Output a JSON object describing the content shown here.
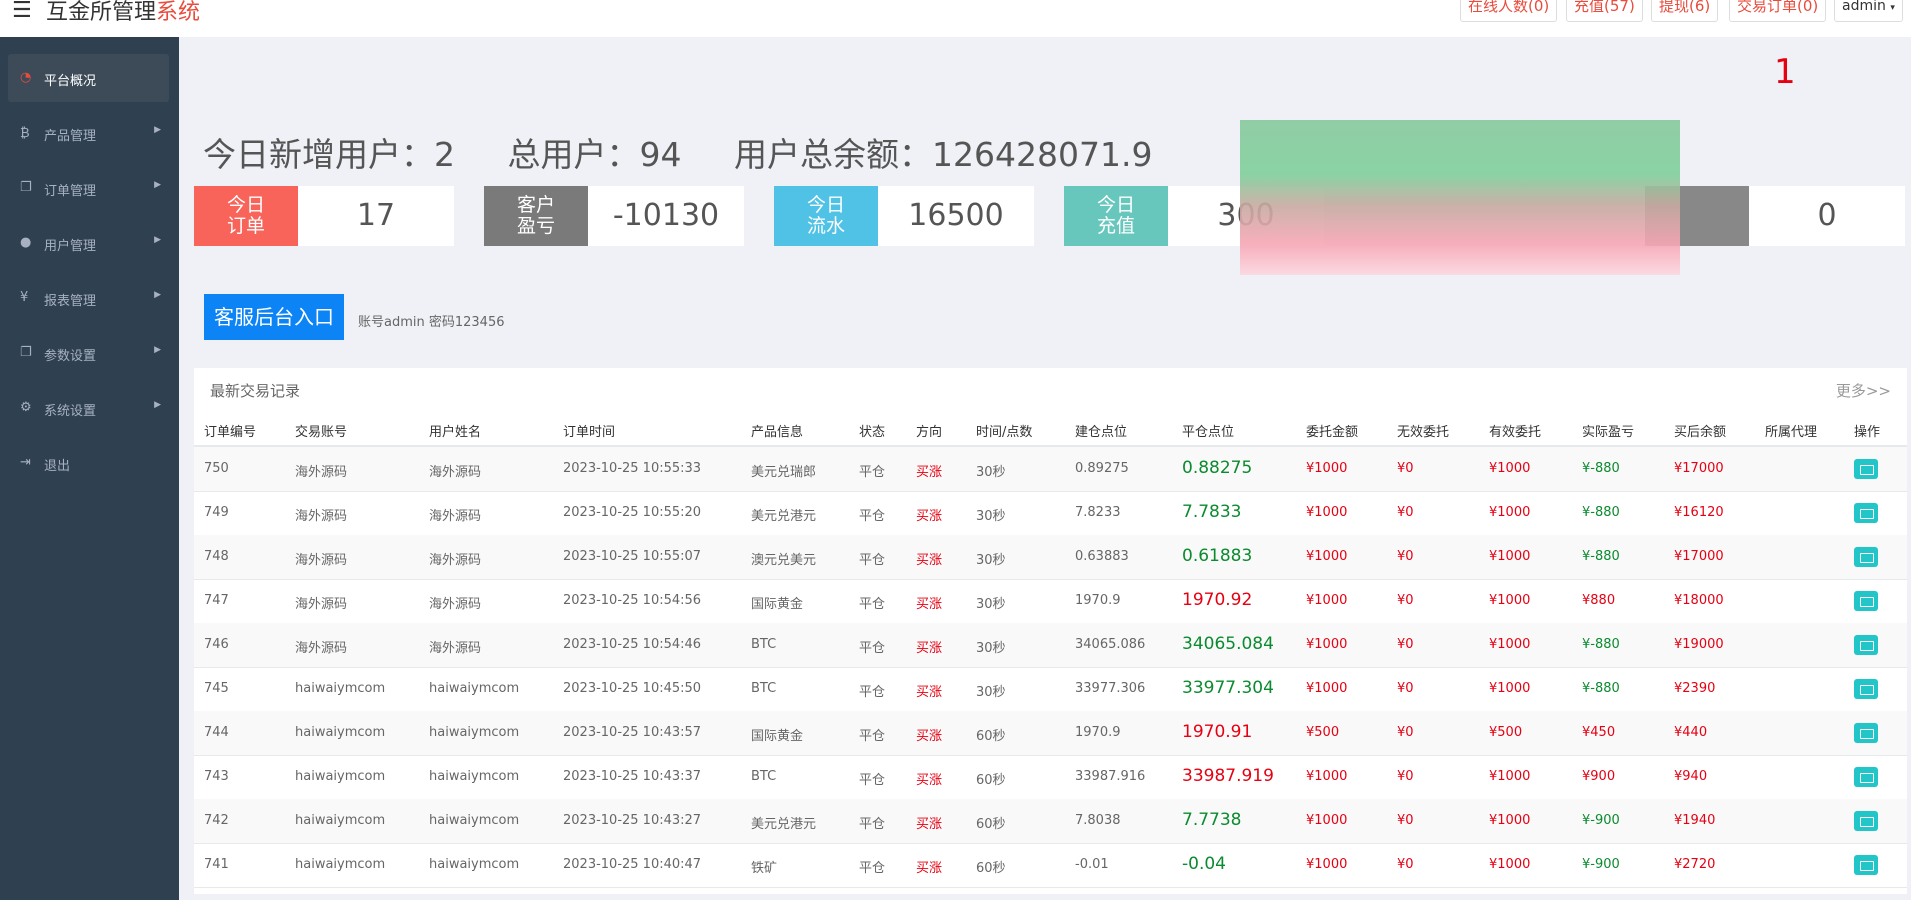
{
  "header": {
    "title_main": "互金所管理",
    "title_accent": "系统",
    "buttons": [
      {
        "label": "在线人数(0)"
      },
      {
        "label": "充值(57)"
      },
      {
        "label": "提现(6)"
      },
      {
        "label": "交易订单(0)"
      }
    ],
    "admin_label": "admin"
  },
  "sidebar": {
    "items": [
      {
        "label": "平台概况",
        "icon": "dashboard-icon",
        "active": true
      },
      {
        "label": "产品管理",
        "icon": "bitcoin-icon"
      },
      {
        "label": "订单管理",
        "icon": "copy-icon"
      },
      {
        "label": "用户管理",
        "icon": "user-icon"
      },
      {
        "label": "报表管理",
        "icon": "yen-icon"
      },
      {
        "label": "参数设置",
        "icon": "copy-icon"
      },
      {
        "label": "系统设置",
        "icon": "gears-icon"
      },
      {
        "label": "退出",
        "icon": "sign-out-icon"
      }
    ]
  },
  "notice_number": "1",
  "stats": {
    "today_new_users": "今日新增用户：2",
    "total_users": "总用户：94",
    "total_balance": "用户总余额：126428071.9"
  },
  "cards": [
    {
      "label": "今日\n订单",
      "value": "17",
      "color": "#f8635a"
    },
    {
      "label": "客户\n盈亏",
      "value": "-10130",
      "color": "#7a7a7a"
    },
    {
      "label": "今日\n流水",
      "value": "16500",
      "color": "#4fc2e5"
    },
    {
      "label": "今日\n充值",
      "value": "300",
      "color": "#67c7bd"
    },
    {
      "label": "",
      "value": "0",
      "color": "#888888"
    }
  ],
  "cs_entry": {
    "button_label": "客服后台入口",
    "hint": "账号admin 密码123456"
  },
  "trades": {
    "title": "最新交易记录",
    "more": "更多>>",
    "columns": [
      "订单编号",
      "交易账号",
      "用户姓名",
      "订单时间",
      "产品信息",
      "状态",
      "方向",
      "时间/点数",
      "建仓点位",
      "平仓点位",
      "委托金额",
      "无效委托",
      "有效委托",
      "实际盈亏",
      "买后余额",
      "所属代理",
      "操作"
    ],
    "rows": [
      {
        "id": "750",
        "account": "海外源码",
        "name": "海外源码",
        "time": "2023-10-25 10:55:33",
        "product": "美元兑瑞郎",
        "status": "平仓",
        "direction": "买涨",
        "period": "30秒",
        "open": "0.89275",
        "close": "0.88275",
        "close_up": false,
        "amount": "¥1000",
        "invalid": "¥0",
        "valid": "¥1000",
        "pnl": "¥-880",
        "pnl_up": false,
        "balance": "¥17000",
        "agent": ""
      },
      {
        "id": "749",
        "account": "海外源码",
        "name": "海外源码",
        "time": "2023-10-25 10:55:20",
        "product": "美元兑港元",
        "status": "平仓",
        "direction": "买涨",
        "period": "30秒",
        "open": "7.8233",
        "close": "7.7833",
        "close_up": false,
        "amount": "¥1000",
        "invalid": "¥0",
        "valid": "¥1000",
        "pnl": "¥-880",
        "pnl_up": false,
        "balance": "¥16120",
        "agent": ""
      },
      {
        "id": "748",
        "account": "海外源码",
        "name": "海外源码",
        "time": "2023-10-25 10:55:07",
        "product": "澳元兑美元",
        "status": "平仓",
        "direction": "买涨",
        "period": "30秒",
        "open": "0.63883",
        "close": "0.61883",
        "close_up": false,
        "amount": "¥1000",
        "invalid": "¥0",
        "valid": "¥1000",
        "pnl": "¥-880",
        "pnl_up": false,
        "balance": "¥17000",
        "agent": ""
      },
      {
        "id": "747",
        "account": "海外源码",
        "name": "海外源码",
        "time": "2023-10-25 10:54:56",
        "product": "国际黄金",
        "status": "平仓",
        "direction": "买涨",
        "period": "30秒",
        "open": "1970.9",
        "close": "1970.92",
        "close_up": true,
        "amount": "¥1000",
        "invalid": "¥0",
        "valid": "¥1000",
        "pnl": "¥880",
        "pnl_up": true,
        "balance": "¥18000",
        "agent": ""
      },
      {
        "id": "746",
        "account": "海外源码",
        "name": "海外源码",
        "time": "2023-10-25 10:54:46",
        "product": "BTC",
        "status": "平仓",
        "direction": "买涨",
        "period": "30秒",
        "open": "34065.086",
        "close": "34065.084",
        "close_up": false,
        "amount": "¥1000",
        "invalid": "¥0",
        "valid": "¥1000",
        "pnl": "¥-880",
        "pnl_up": false,
        "balance": "¥19000",
        "agent": ""
      },
      {
        "id": "745",
        "account": "haiwaiymcom",
        "name": "haiwaiymcom",
        "time": "2023-10-25 10:45:50",
        "product": "BTC",
        "status": "平仓",
        "direction": "买涨",
        "period": "30秒",
        "open": "33977.306",
        "close": "33977.304",
        "close_up": false,
        "amount": "¥1000",
        "invalid": "¥0",
        "valid": "¥1000",
        "pnl": "¥-880",
        "pnl_up": false,
        "balance": "¥2390",
        "agent": ""
      },
      {
        "id": "744",
        "account": "haiwaiymcom",
        "name": "haiwaiymcom",
        "time": "2023-10-25 10:43:57",
        "product": "国际黄金",
        "status": "平仓",
        "direction": "买涨",
        "period": "60秒",
        "open": "1970.9",
        "close": "1970.91",
        "close_up": true,
        "amount": "¥500",
        "invalid": "¥0",
        "valid": "¥500",
        "pnl": "¥450",
        "pnl_up": true,
        "balance": "¥440",
        "agent": ""
      },
      {
        "id": "743",
        "account": "haiwaiymcom",
        "name": "haiwaiymcom",
        "time": "2023-10-25 10:43:37",
        "product": "BTC",
        "status": "平仓",
        "direction": "买涨",
        "period": "60秒",
        "open": "33987.916",
        "close": "33987.919",
        "close_up": true,
        "amount": "¥1000",
        "invalid": "¥0",
        "valid": "¥1000",
        "pnl": "¥900",
        "pnl_up": true,
        "balance": "¥940",
        "agent": ""
      },
      {
        "id": "742",
        "account": "haiwaiymcom",
        "name": "haiwaiymcom",
        "time": "2023-10-25 10:43:27",
        "product": "美元兑港元",
        "status": "平仓",
        "direction": "买涨",
        "period": "60秒",
        "open": "7.8038",
        "close": "7.7738",
        "close_up": false,
        "amount": "¥1000",
        "invalid": "¥0",
        "valid": "¥1000",
        "pnl": "¥-900",
        "pnl_up": false,
        "balance": "¥1940",
        "agent": ""
      },
      {
        "id": "741",
        "account": "haiwaiymcom",
        "name": "haiwaiymcom",
        "time": "2023-10-25 10:40:47",
        "product": "铁矿",
        "status": "平仓",
        "direction": "买涨",
        "period": "60秒",
        "open": "-0.01",
        "close": "-0.04",
        "close_up": false,
        "amount": "¥1000",
        "invalid": "¥0",
        "valid": "¥1000",
        "pnl": "¥-900",
        "pnl_up": false,
        "balance": "¥2720",
        "agent": ""
      }
    ]
  },
  "colors": {
    "accent_red": "#e84c3d",
    "up_red": "#e60012",
    "down_green": "#0b8b2f",
    "sidebar_bg": "#2f4050",
    "cs_button_blue": "#0c84f5"
  }
}
